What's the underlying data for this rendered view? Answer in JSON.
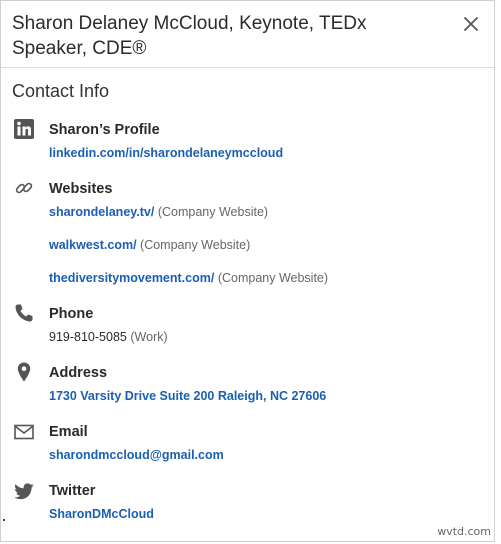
{
  "header": {
    "title": "Sharon Delaney McCloud, Keynote, TEDx Speaker, CDE®"
  },
  "section_title": "Contact Info",
  "profile": {
    "label": "Sharon’s Profile",
    "url": "linkedin.com/in/sharondelaneymccloud"
  },
  "websites": {
    "label": "Websites",
    "items": [
      {
        "url": "sharondelaney.tv/",
        "type": "(Company Website)"
      },
      {
        "url": "walkwest.com/",
        "type": "(Company Website)"
      },
      {
        "url": "thediversitymovement.com/",
        "type": "(Company Website)"
      }
    ]
  },
  "phone": {
    "label": "Phone",
    "number": "919-810-5085",
    "type": "(Work)"
  },
  "address": {
    "label": "Address",
    "value": "1730 Varsity Drive Suite 200 Raleigh, NC 27606"
  },
  "email": {
    "label": "Email",
    "value": "sharondmccloud@gmail.com"
  },
  "twitter": {
    "label": "Twitter",
    "handle": "SharonDMcCloud"
  },
  "watermark": "wvtd.com",
  "icons": {
    "close": "close-icon",
    "linkedin": "linkedin-icon",
    "link": "link-icon",
    "phone": "phone-icon",
    "location": "location-pin-icon",
    "email": "envelope-icon",
    "twitter": "twitter-bird-icon"
  },
  "colors": {
    "link": "#1a5fb4",
    "icon": "#555555",
    "muted": "#666666"
  }
}
